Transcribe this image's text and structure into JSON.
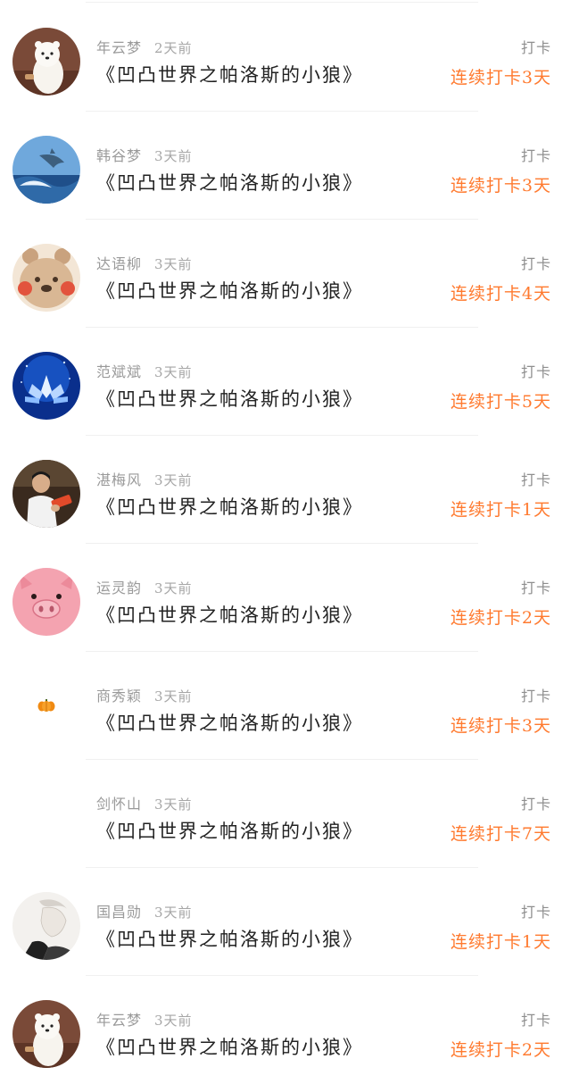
{
  "colors": {
    "accent": "#ff7a2f",
    "name_text": "#9a9a9a",
    "title_text": "#222222",
    "divider": "#f0f0f0"
  },
  "records": [
    {
      "user": "年云梦",
      "time": "2天前",
      "book": "《凹凸世界之帕洛斯的小狼》",
      "type": "打卡",
      "streak": "连续打卡3天",
      "avatar": "polar-bear-avatar"
    },
    {
      "user": "韩谷梦",
      "time": "3天前",
      "book": "《凹凸世界之帕洛斯的小狼》",
      "type": "打卡",
      "streak": "连续打卡3天",
      "avatar": "dolphin-avatar"
    },
    {
      "user": "达语柳",
      "time": "3天前",
      "book": "《凹凸世界之帕洛斯的小狼》",
      "type": "打卡",
      "streak": "连续打卡4天",
      "avatar": "cartoon-bear-avatar"
    },
    {
      "user": "范斌斌",
      "time": "3天前",
      "book": "《凹凸世界之帕洛斯的小狼》",
      "type": "打卡",
      "streak": "连续打卡5天",
      "avatar": "lotus-avatar"
    },
    {
      "user": "湛梅风",
      "time": "3天前",
      "book": "《凹凸世界之帕洛斯的小狼》",
      "type": "打卡",
      "streak": "连续打卡1天",
      "avatar": "photo-person-avatar"
    },
    {
      "user": "运灵韵",
      "time": "3天前",
      "book": "《凹凸世界之帕洛斯的小狼》",
      "type": "打卡",
      "streak": "连续打卡2天",
      "avatar": "pig-avatar"
    },
    {
      "user": "商秀颖",
      "time": "3天前",
      "book": "《凹凸世界之帕洛斯的小狼》",
      "type": "打卡",
      "streak": "连续打卡3天",
      "avatar": "pumpkin-avatar"
    },
    {
      "user": "剑怀山",
      "time": "3天前",
      "book": "《凹凸世界之帕洛斯的小狼》",
      "type": "打卡",
      "streak": "连续打卡7天",
      "avatar": "blank-avatar"
    },
    {
      "user": "国昌勋",
      "time": "3天前",
      "book": "《凹凸世界之帕洛斯的小狼》",
      "type": "打卡",
      "streak": "连续打卡1天",
      "avatar": "sketch-person-avatar"
    },
    {
      "user": "年云梦",
      "time": "3天前",
      "book": "《凹凸世界之帕洛斯的小狼》",
      "type": "打卡",
      "streak": "连续打卡2天",
      "avatar": "polar-bear-avatar"
    }
  ]
}
